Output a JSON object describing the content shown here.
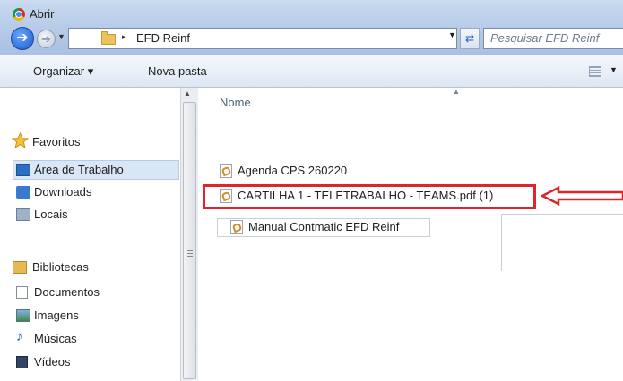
{
  "window": {
    "title": "Abrir",
    "app_icon": "chrome-logo-icon"
  },
  "address": {
    "breadcrumb_arrow": "▸",
    "current_folder": "EFD Reinf"
  },
  "search": {
    "placeholder": "Pesquisar EFD Reinf"
  },
  "toolbar": {
    "organize_label": "Organizar ▾",
    "new_folder_label": "Nova pasta"
  },
  "sidebar": {
    "favorites_label": "Favoritos",
    "favorites": [
      {
        "label": "Área de Trabalho",
        "icon": "desktop-icon",
        "selected": true
      },
      {
        "label": "Downloads",
        "icon": "downloads-folder-icon"
      },
      {
        "label": "Locais",
        "icon": "recent-places-icon"
      }
    ],
    "libraries_label": "Bibliotecas",
    "libraries": [
      {
        "label": "Documentos",
        "icon": "documents-icon"
      },
      {
        "label": "Imagens",
        "icon": "pictures-icon"
      },
      {
        "label": "Músicas",
        "icon": "music-icon"
      },
      {
        "label": "Vídeos",
        "icon": "videos-icon"
      }
    ]
  },
  "files": {
    "column_name": "Nome",
    "items": [
      {
        "name": "Agenda CPS 260220",
        "icon": "pdf-file-icon"
      },
      {
        "name": "CARTILHA 1 - TELETRABALHO - TEAMS.pdf (1)",
        "icon": "pdf-file-icon",
        "highlighted": true
      },
      {
        "name": "Manual Contmatic EFD Reinf",
        "icon": "pdf-file-icon"
      }
    ]
  },
  "colors": {
    "highlight": "#e0242b",
    "selection": "#d8e6f5"
  }
}
